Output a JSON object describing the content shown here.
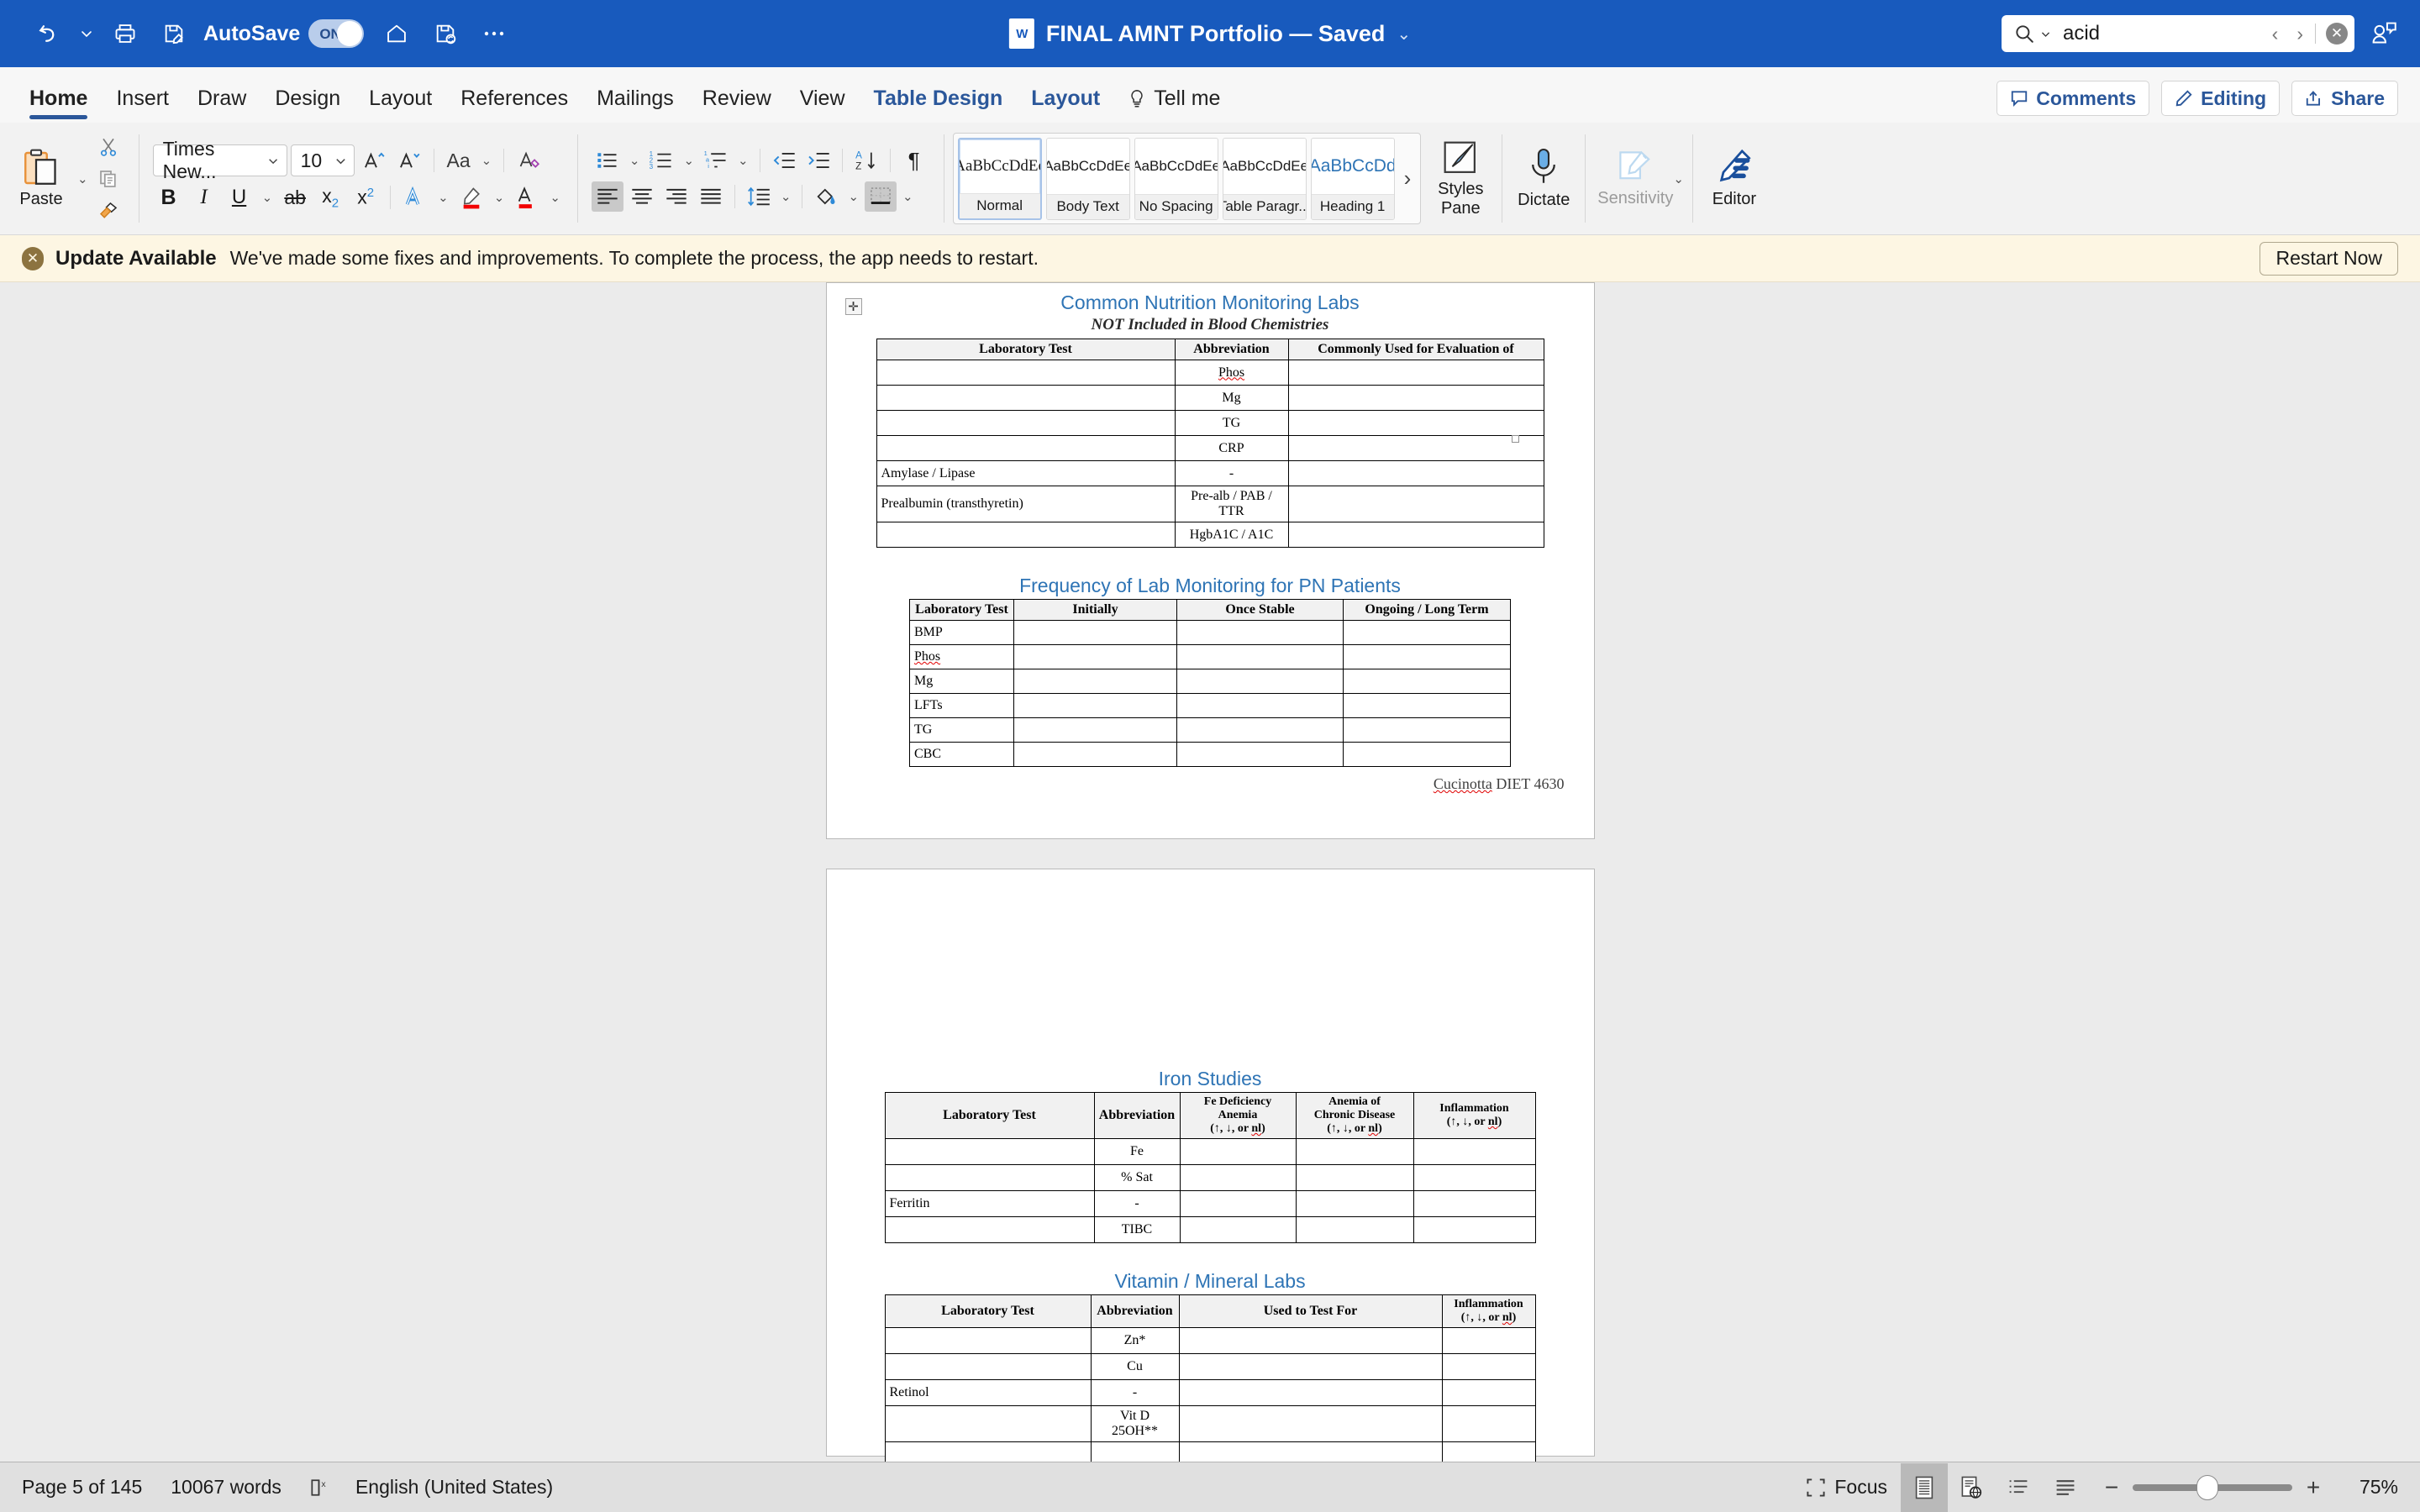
{
  "titlebar": {
    "autosave_label": "AutoSave",
    "autosave_state": "ON",
    "doc_title": "FINAL AMNT Portfolio — Saved",
    "doc_icon_mark": "W",
    "icons": [
      "undo-icon",
      "undo-dropdown-icon",
      "print-icon",
      "save-as-icon",
      "home-icon",
      "sync-save-icon",
      "more-commands-icon"
    ],
    "search": {
      "value": "acid",
      "placeholder": "Search",
      "prev": "‹",
      "next": "›",
      "clear": "✕"
    },
    "brand_color": "#185abd"
  },
  "ribbon_tabs": {
    "items": [
      {
        "label": "Home",
        "state": "active"
      },
      {
        "label": "Insert",
        "state": "normal"
      },
      {
        "label": "Draw",
        "state": "normal"
      },
      {
        "label": "Design",
        "state": "normal"
      },
      {
        "label": "Layout",
        "state": "normal"
      },
      {
        "label": "References",
        "state": "normal"
      },
      {
        "label": "Mailings",
        "state": "normal"
      },
      {
        "label": "Review",
        "state": "normal"
      },
      {
        "label": "View",
        "state": "normal"
      },
      {
        "label": "Table Design",
        "state": "contextual"
      },
      {
        "label": "Layout",
        "state": "contextual"
      }
    ],
    "tell_me": "Tell me",
    "comments": "Comments",
    "editing": "Editing",
    "share": "Share",
    "accent": "#2b579a"
  },
  "ribbon": {
    "paste_label": "Paste",
    "font_name": "Times New...",
    "font_size": "10",
    "case_label": "Aa",
    "styles": [
      {
        "preview": "AaBbCcDdEe",
        "caption": "Normal",
        "selected": true
      },
      {
        "preview": "AaBbCcDdEe",
        "caption": "Body Text",
        "selected": false
      },
      {
        "preview": "AaBbCcDdEe",
        "caption": "No Spacing",
        "selected": false
      },
      {
        "preview": "AaBbCcDdEe",
        "caption": "Table Paragr...",
        "selected": false
      },
      {
        "preview": "AaBbCcDd",
        "caption": "Heading 1",
        "selected": false
      }
    ],
    "gallery_more": "›",
    "styles_pane": "Styles\nPane",
    "styles_pane_line1": "Styles",
    "styles_pane_line2": "Pane",
    "dictate": "Dictate",
    "sensitivity": "Sensitivity",
    "editor": "Editor"
  },
  "update_bar": {
    "title": "Update Available",
    "message": "We've made some fixes and improvements. To complete the process, the app needs to restart.",
    "button": "Restart Now",
    "background": "#fdf6e3"
  },
  "document": {
    "tables": [
      {
        "title": "Common Nutrition Monitoring Labs",
        "subtitle": "NOT Included in Blood Chemistries",
        "headers": [
          "Laboratory Test",
          "Abbreviation",
          "Commonly Used for Evaluation of"
        ],
        "rows": [
          [
            "",
            "Phos",
            ""
          ],
          [
            "",
            "Mg",
            ""
          ],
          [
            "",
            "TG",
            ""
          ],
          [
            "",
            "CRP",
            ""
          ],
          [
            "Amylase / Lipase",
            "-",
            ""
          ],
          [
            "Prealbumin (transthyretin)",
            "Pre-alb / PAB / TTR",
            ""
          ],
          [
            "",
            "HgbA1C / A1C",
            ""
          ]
        ]
      },
      {
        "title": "Frequency of Lab Monitoring for PN Patients",
        "subtitle": "",
        "headers": [
          "Laboratory Test",
          "Initially",
          "Once Stable",
          "Ongoing / Long Term"
        ],
        "rows": [
          [
            "BMP",
            "",
            "",
            ""
          ],
          [
            "Phos",
            "",
            "",
            ""
          ],
          [
            "Mg",
            "",
            "",
            ""
          ],
          [
            "LFTs",
            "",
            "",
            ""
          ],
          [
            "TG",
            "",
            "",
            ""
          ],
          [
            "CBC",
            "",
            "",
            ""
          ]
        ]
      },
      {
        "title": "Iron Studies",
        "subtitle": "",
        "headers": [
          "Laboratory Test",
          "Abbreviation",
          "Fe Deficiency Anemia (↑, ↓, or nl)",
          "Anemia of Chronic Disease (↑, ↓, or nl)",
          "Inflammation (↑, ↓, or nl)"
        ],
        "rows": [
          [
            "",
            "Fe",
            "",
            "",
            ""
          ],
          [
            "",
            "% Sat",
            "",
            "",
            ""
          ],
          [
            "Ferritin",
            "-",
            "",
            "",
            ""
          ],
          [
            "",
            "TIBC",
            "",
            "",
            ""
          ]
        ]
      },
      {
        "title": "Vitamin / Mineral Labs",
        "subtitle": "",
        "headers": [
          "Laboratory Test",
          "Abbreviation",
          "Used to Test For",
          "Inflammation (↑, ↓, or nl)"
        ],
        "rows": [
          [
            "",
            "Zn*",
            "",
            ""
          ],
          [
            "",
            "Cu",
            "",
            ""
          ],
          [
            "Retinol",
            "-",
            "",
            ""
          ],
          [
            "",
            "Vit D 25OH**",
            "",
            ""
          ]
        ]
      }
    ],
    "footer_note": "Cucinotta DIET 4630",
    "title_color": "#2e74b5"
  },
  "statusbar": {
    "page": "Page 5 of 145",
    "words": "10067 words",
    "proofing_icon": "proofing-errors-icon",
    "language": "English (United States)",
    "focus": "Focus",
    "zoom_value": "75%",
    "zoom_out": "−",
    "zoom_in": "+"
  }
}
